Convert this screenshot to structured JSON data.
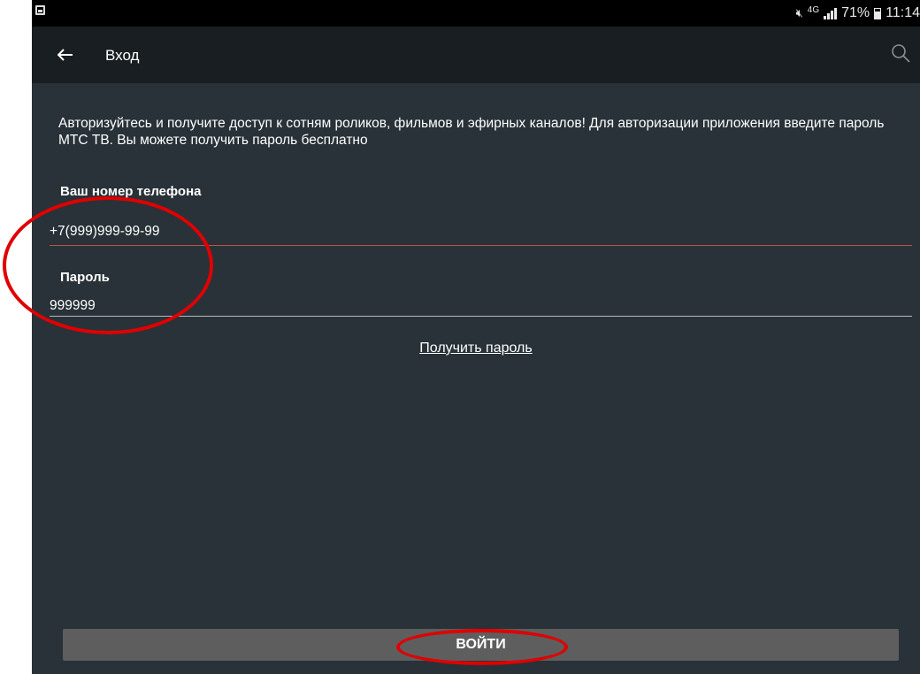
{
  "status_bar": {
    "network": "4G",
    "battery": "71%",
    "time": "11:14",
    "icons": [
      "image-notification-icon",
      "mute-icon",
      "signal-icon",
      "battery-icon"
    ]
  },
  "appbar": {
    "title": "Вход",
    "icons": {
      "back": "arrow-left-icon",
      "search": "search-icon"
    }
  },
  "login": {
    "intro": "Авторизуйтесь и получите доступ к сотням роликов, фильмов и эфирных каналов! Для авторизации приложения введите пароль МТС ТВ. Вы можете получить пароль бесплатно",
    "phone_label": "Ваш номер телефона",
    "phone_value": "+7(999)999-99-99",
    "password_label": "Пароль",
    "password_value": "999999",
    "get_password_link": "Получить пароль",
    "submit_label": "ВОЙТИ"
  },
  "colors": {
    "background": "#283238",
    "appbar": "#191e22",
    "focused_underline": "#c0504d",
    "button": "#5e5e5e",
    "annotation": "#e00000"
  }
}
